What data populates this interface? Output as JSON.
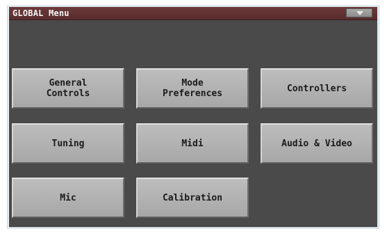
{
  "window": {
    "title": "GLOBAL Menu"
  },
  "icons": {
    "menu": "chevron-down-icon"
  },
  "colors": {
    "title_bar": "#5f3030",
    "screen_bg": "#4a4a4a",
    "button_face": "#b3b3b3",
    "frame": "#e6f1f7"
  },
  "buttons": [
    {
      "label": "General\nControls"
    },
    {
      "label": "Mode\nPreferences"
    },
    {
      "label": "Controllers"
    },
    {
      "label": "Tuning"
    },
    {
      "label": "Midi"
    },
    {
      "label": "Audio & Video"
    },
    {
      "label": "Mic"
    },
    {
      "label": "Calibration"
    }
  ]
}
